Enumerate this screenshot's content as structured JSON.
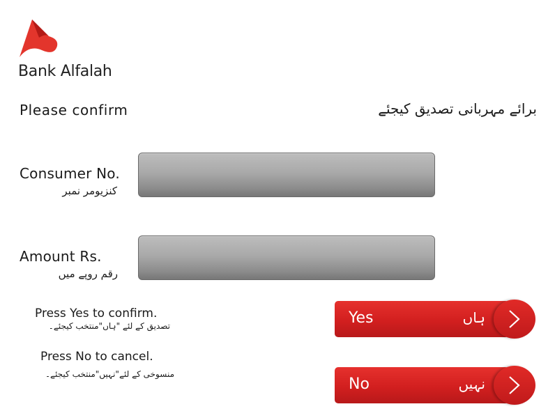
{
  "brand": {
    "name": "Bank Alfalah",
    "color": "#d6281f"
  },
  "header": {
    "title_en": "Please confirm",
    "title_ur": "برائے مہربانی تصدیق کیجئے"
  },
  "fields": {
    "consumer": {
      "label_en": "Consumer No.",
      "label_ur": "کنزیومر نمبر",
      "value": ""
    },
    "amount": {
      "label_en": "Amount Rs.",
      "label_ur": "رقم روپے میں",
      "value": ""
    }
  },
  "instructions": {
    "yes_en": "Press Yes to confirm.",
    "yes_ur": "تصدیق کے لئے \"ہاں\"منتخب کیجئے۔",
    "no_en": "Press No to cancel.",
    "no_ur": "منسوخی کے لئے\"نہیں\"منتخب کیجئے۔"
  },
  "buttons": {
    "yes": {
      "label_en": "Yes",
      "label_ur": "ہاں",
      "icon": "chevron-right-icon"
    },
    "no": {
      "label_en": "No",
      "label_ur": "نہیں",
      "icon": "chevron-right-icon"
    }
  }
}
